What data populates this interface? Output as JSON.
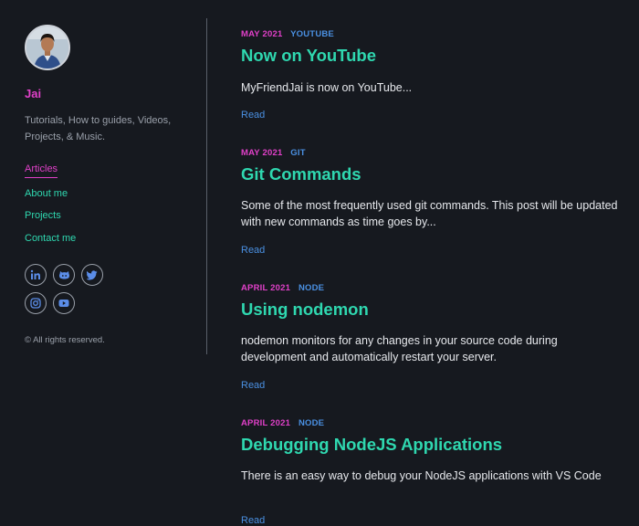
{
  "sidebar": {
    "site_name": "Jai",
    "tagline": "Tutorials, How to guides, Videos, Projects, & Music.",
    "nav": [
      {
        "label": "Articles"
      },
      {
        "label": "About me"
      },
      {
        "label": "Projects"
      },
      {
        "label": "Contact me"
      }
    ],
    "socials": [
      "linkedin-icon",
      "github-icon",
      "twitter-icon",
      "instagram-icon",
      "youtube-icon"
    ],
    "copyright": "© All rights reserved."
  },
  "posts": [
    {
      "date": "MAY 2021",
      "tag": "YOUTUBE",
      "title": "Now on YouTube",
      "excerpt": "MyFriendJai is now on YouTube...",
      "read": "Read"
    },
    {
      "date": "MAY 2021",
      "tag": "GIT",
      "title": "Git Commands",
      "excerpt": "Some of the most frequently used git commands. This post will be updated with new commands as time goes by...",
      "read": "Read"
    },
    {
      "date": "APRIL 2021",
      "tag": "NODE",
      "title": "Using nodemon",
      "excerpt": "nodemon monitors for any changes in your source code during development and automatically restart your server.",
      "read": "Read"
    },
    {
      "date": "APRIL 2021",
      "tag": "NODE",
      "title": "Debugging NodeJS Applications",
      "excerpt": "There is an easy way to debug your NodeJS applications with VS Code",
      "read": "Read"
    }
  ],
  "colors": {
    "background": "#16191f",
    "accent_pink": "#e040c8",
    "accent_teal": "#2fd8b0",
    "link_blue": "#4a90e2"
  }
}
